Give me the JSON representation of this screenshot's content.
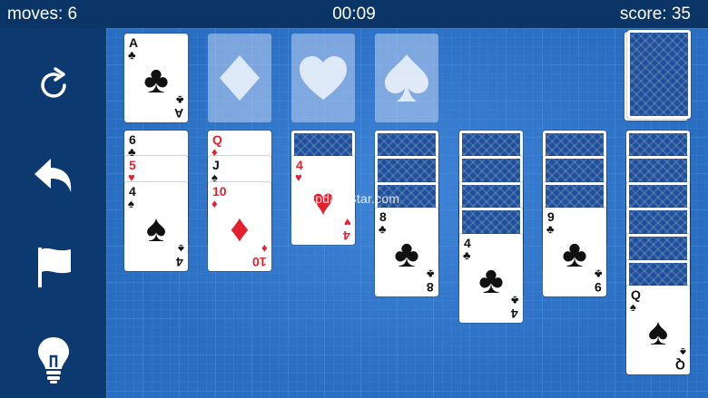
{
  "header": {
    "moves": "moves: 6",
    "timer": "00:09",
    "score": "score: 35"
  },
  "sidebar": {
    "buttons": [
      {
        "name": "new-game",
        "icon": "refresh-icon"
      },
      {
        "name": "undo",
        "icon": "undo-arrow-icon"
      },
      {
        "name": "give-up",
        "icon": "flag-icon"
      },
      {
        "name": "hint",
        "icon": "lightbulb-icon"
      }
    ]
  },
  "foundations": [
    {
      "rank": "A",
      "suit": "♣",
      "color": "black"
    },
    {
      "placeholder_suit": "♦"
    },
    {
      "placeholder_suit": "♥"
    },
    {
      "placeholder_suit": "♠"
    }
  ],
  "tableau": [
    {
      "facedown": 0,
      "faceup": [
        {
          "rank": "6",
          "suit": "♣",
          "color": "black"
        },
        {
          "rank": "5",
          "suit": "♥",
          "color": "red"
        },
        {
          "rank": "4",
          "suit": "♠",
          "color": "black"
        }
      ]
    },
    {
      "facedown": 0,
      "faceup": [
        {
          "rank": "Q",
          "suit": "♦",
          "color": "red"
        },
        {
          "rank": "J",
          "suit": "♠",
          "color": "black"
        },
        {
          "rank": "10",
          "suit": "♦",
          "color": "red"
        }
      ]
    },
    {
      "facedown": 1,
      "faceup": [
        {
          "rank": "4",
          "suit": "♥",
          "color": "red"
        }
      ]
    },
    {
      "facedown": 3,
      "faceup": [
        {
          "rank": "8",
          "suit": "♣",
          "color": "black"
        }
      ]
    },
    {
      "facedown": 4,
      "faceup": [
        {
          "rank": "4",
          "suit": "♣",
          "color": "black"
        }
      ]
    },
    {
      "facedown": 3,
      "faceup": [
        {
          "rank": "9",
          "suit": "♣",
          "color": "black"
        }
      ]
    },
    {
      "facedown": 6,
      "faceup": [
        {
          "rank": "Q",
          "suit": "♠",
          "color": "black"
        }
      ]
    }
  ],
  "watermark": "UpdateStar.com"
}
